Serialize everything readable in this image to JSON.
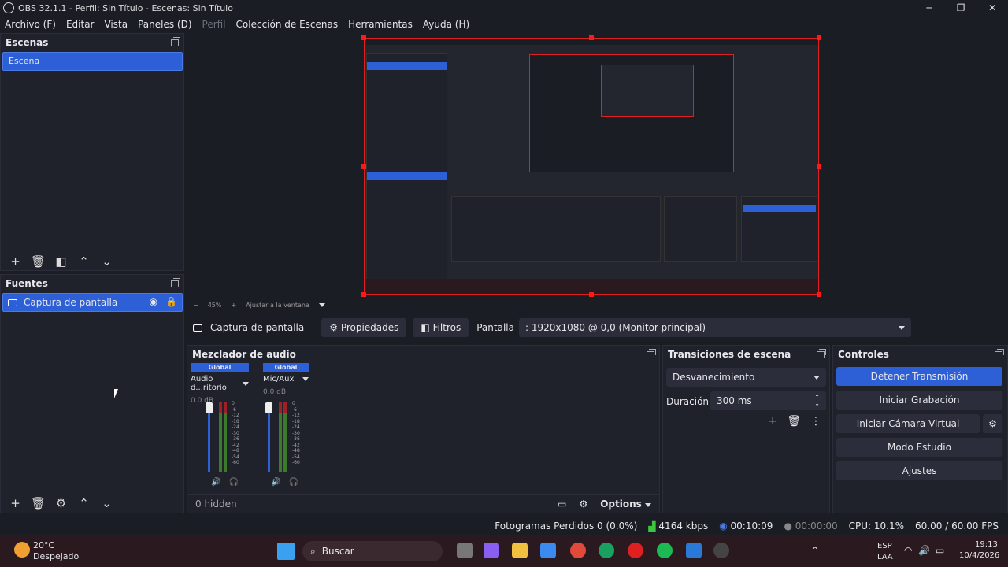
{
  "window": {
    "title": "OBS 32.1.1 - Perfil: Sin Título - Escenas: Sin Título",
    "minimize": "─",
    "maximize": "❐",
    "close": "✕"
  },
  "menu": [
    "Archivo (F)",
    "Editar",
    "Vista",
    "Paneles (D)",
    "Perfil",
    "Colección de Escenas",
    "Herramientas",
    "Ayuda (H)"
  ],
  "scenes": {
    "title": "Escenas",
    "items": [
      "Escena"
    ]
  },
  "sources": {
    "title": "Fuentes",
    "items": [
      "Captura de pantalla"
    ]
  },
  "preview": {
    "zoom": "45%",
    "fit_label": "Ajustar a la ventana"
  },
  "source_bar": {
    "name": "Captura de pantalla",
    "properties": "Propiedades",
    "filters": "Filtros",
    "display_label": "Pantalla",
    "display_value": ": 1920x1080 @ 0,0 (Monitor principal)"
  },
  "mixer": {
    "title": "Mezclador de audio",
    "channels": [
      {
        "badge": "Global",
        "name": "Audio d...ritorio",
        "level": "0.0 dB"
      },
      {
        "badge": "Global",
        "name": "Mic/Aux",
        "level": "0.0 dB"
      }
    ],
    "scale": [
      "0",
      "-6",
      "-12",
      "-18",
      "-24",
      "-30",
      "-36",
      "-42",
      "-48",
      "-54",
      "-60"
    ],
    "hidden": "0 hidden",
    "options": "Options"
  },
  "transitions": {
    "title": "Transiciones de escena",
    "selected": "Desvanecimiento",
    "duration_label": "Duración",
    "duration_value": "300 ms"
  },
  "controls": {
    "title": "Controles",
    "buttons": [
      "Detener Transmisión",
      "Iniciar Grabación",
      "Iniciar Cámara Virtual",
      "Modo Estudio",
      "Ajustes"
    ]
  },
  "status": {
    "frames": "Fotogramas Perdidos 0 (0.0%)",
    "bitrate": "4164 kbps",
    "stream_time": "00:10:09",
    "rec_time": "00:00:00",
    "cpu": "CPU: 10.1%",
    "fps": "60.00 / 60.00 FPS"
  },
  "taskbar": {
    "temp": "20°C",
    "weather": "Despejado",
    "search": "Buscar",
    "lang1": "ESP",
    "lang2": "LAA",
    "time": "19:13",
    "date": "10/4/2026"
  },
  "colors": {
    "accent": "#2d5fd6",
    "bg": "#1b1d25",
    "panel": "#1f212b",
    "taskbar": "#2a1a20"
  }
}
